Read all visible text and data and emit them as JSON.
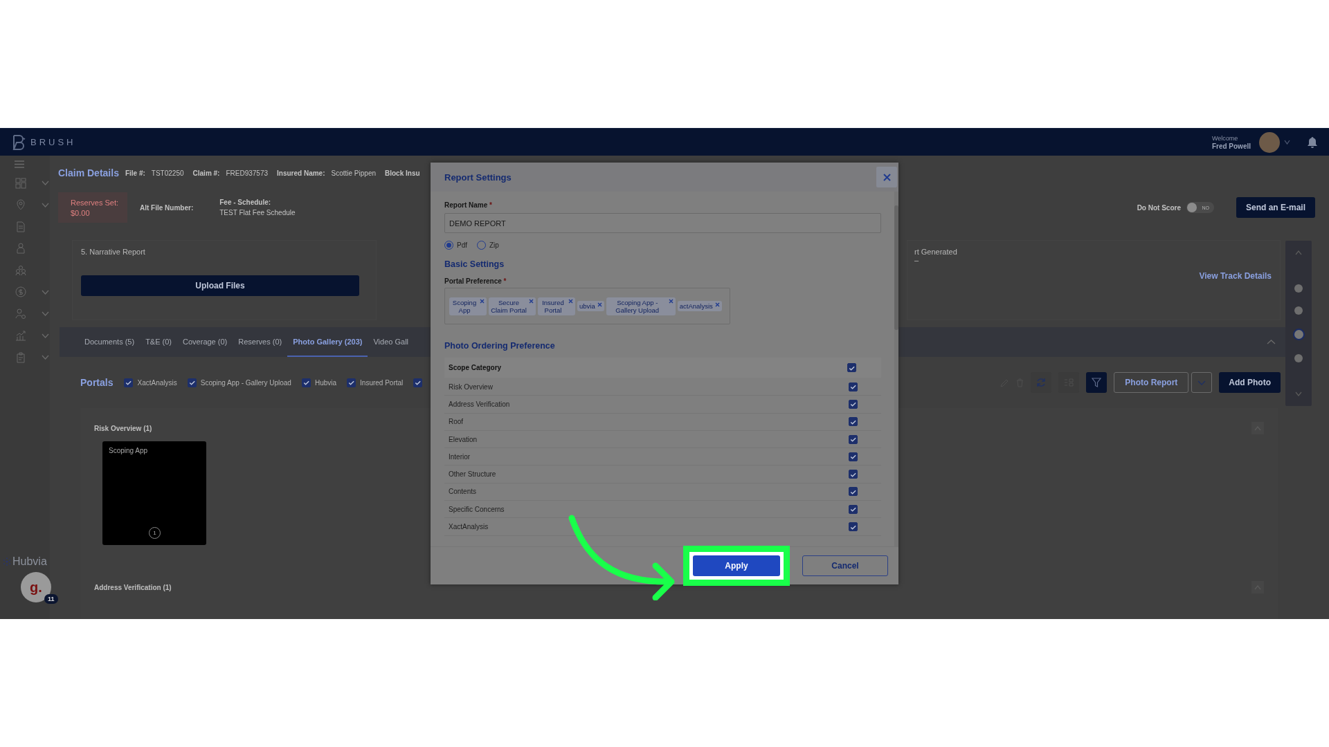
{
  "top_bar": {
    "logo": "BRUSH",
    "welcome": "Welcome",
    "user": "Fred Powell"
  },
  "sidebar": {
    "items": [
      {
        "expandable": true
      },
      {
        "expandable": true
      },
      {
        "expandable": false
      },
      {
        "expandable": false
      },
      {
        "expandable": false
      },
      {
        "expandable": true
      },
      {
        "expandable": true
      },
      {
        "expandable": true
      },
      {
        "expandable": true
      }
    ],
    "brand": "Hubvia",
    "chat_avatar": "g.",
    "chat_badge": "11"
  },
  "claim_header": {
    "title": "Claim Details",
    "fields": [
      {
        "label": "File #:",
        "value": "TST02250"
      },
      {
        "label": "Claim #:",
        "value": "FRED937573"
      },
      {
        "label": "Insured Name:",
        "value": "Scottie Pippen"
      },
      {
        "label": "Block Insu"
      }
    ]
  },
  "summary": {
    "reserves": {
      "label": "Reserves Set:",
      "value": "$0.00"
    },
    "alt_file": {
      "label": "Alt File Number:"
    },
    "fee_schedule": {
      "label": "Fee - Schedule:",
      "value": "TEST Flat Fee Schedule"
    },
    "do_not_score": {
      "label": "Do Not Score",
      "on": false,
      "state_text": "NO"
    },
    "email_button": "Send an E-mail"
  },
  "narrative": {
    "title": "5. Narrative Report",
    "upload_button": "Upload Files"
  },
  "report_status": {
    "label": "rt Generated",
    "value": "–",
    "link": "View Track Details"
  },
  "tabs": [
    {
      "label": "Documents (5)",
      "selected": false
    },
    {
      "label": "T&E (0)",
      "selected": false
    },
    {
      "label": "Coverage (0)",
      "selected": false
    },
    {
      "label": "Reserves (0)",
      "selected": false
    },
    {
      "label": "Photo Gallery (203)",
      "selected": true
    },
    {
      "label": "Video Gall",
      "selected": false
    }
  ],
  "portals": {
    "title": "Portals",
    "filters": [
      {
        "label": "XactAnalysis",
        "checked": true
      },
      {
        "label": "Scoping App - Gallery Upload",
        "checked": true
      },
      {
        "label": "Hubvia",
        "checked": true
      },
      {
        "label": "Insured Portal",
        "checked": true
      },
      {
        "checked": true
      }
    ]
  },
  "toolbar": {
    "photo_report": "Photo Report",
    "add_photo": "Add Photo"
  },
  "gallery": {
    "sections": [
      {
        "title": "Risk Overview (1)",
        "photos": [
          {
            "source": "Scoping App",
            "count": "1"
          }
        ]
      },
      {
        "title": "Address Verification (1)"
      }
    ]
  },
  "page_nav": {
    "dots": [
      {
        "selected": false
      },
      {
        "selected": false
      },
      {
        "selected": true
      },
      {
        "selected": false
      }
    ]
  },
  "dialog": {
    "title": "Report Settings",
    "report_name": {
      "label": "Report Name",
      "required_mark": "*",
      "value": "DEMO REPORT"
    },
    "formats": [
      {
        "label": "Pdf",
        "selected": true
      },
      {
        "label": "Zip",
        "selected": false
      }
    ],
    "basic_settings": "Basic Settings",
    "portal_preference": {
      "label": "Portal Preference",
      "required_mark": "*",
      "tags": [
        {
          "label": "Scoping App"
        },
        {
          "label": "Secure Claim Portal"
        },
        {
          "label": "Insured Portal"
        },
        {
          "label": "ubvia"
        },
        {
          "label": "Scoping App - Gallery Upload"
        },
        {
          "label": "actAnalysis"
        }
      ]
    },
    "photo_ordering": {
      "title": "Photo Ordering Preference",
      "header": {
        "label": "Scope Category",
        "checked": true
      },
      "rows": [
        {
          "label": "Risk Overview",
          "checked": true
        },
        {
          "label": "Address Verification",
          "checked": true
        },
        {
          "label": "Roof",
          "checked": true
        },
        {
          "label": "Elevation",
          "checked": true
        },
        {
          "label": "Interior",
          "checked": true
        },
        {
          "label": "Other Structure",
          "checked": true
        },
        {
          "label": "Contents",
          "checked": true
        },
        {
          "label": "Specific Concerns",
          "checked": true
        },
        {
          "label": "XactAnalysis",
          "checked": true
        }
      ]
    },
    "apply_button": "Apply",
    "cancel_button": "Cancel"
  },
  "callout": {
    "kind": "arrow_highlight"
  }
}
